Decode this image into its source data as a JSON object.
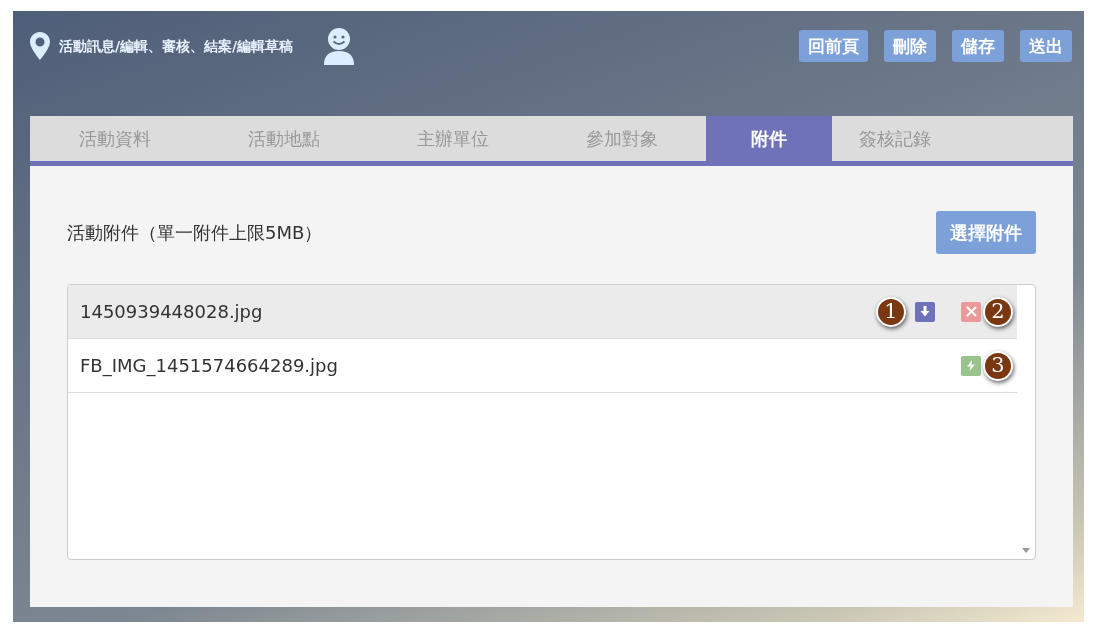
{
  "header": {
    "title": "活動訊息/編輯、審核、結案/編輯草稿",
    "buttons": [
      "回前頁",
      "刪除",
      "儲存",
      "送出"
    ]
  },
  "tabs": [
    {
      "label": "活動資料",
      "selected": false
    },
    {
      "label": "活動地點",
      "selected": false
    },
    {
      "label": "主辦單位",
      "selected": false
    },
    {
      "label": "參加對象",
      "selected": false
    },
    {
      "label": "附件",
      "selected": true
    },
    {
      "label": "簽核記錄",
      "selected": false
    }
  ],
  "attachments": {
    "heading": "活動附件（單一附件上限5MB）",
    "choose_button": "選擇附件",
    "files": [
      {
        "name": "1450939448028.jpg",
        "selected": true,
        "actions": [
          {
            "kind": "download",
            "callout": "1"
          },
          {
            "kind": "delete",
            "callout": "2"
          }
        ]
      },
      {
        "name": "FB_IMG_1451574664289.jpg",
        "selected": false,
        "actions": [
          {
            "kind": "flash",
            "callout": "3"
          }
        ]
      }
    ]
  }
}
